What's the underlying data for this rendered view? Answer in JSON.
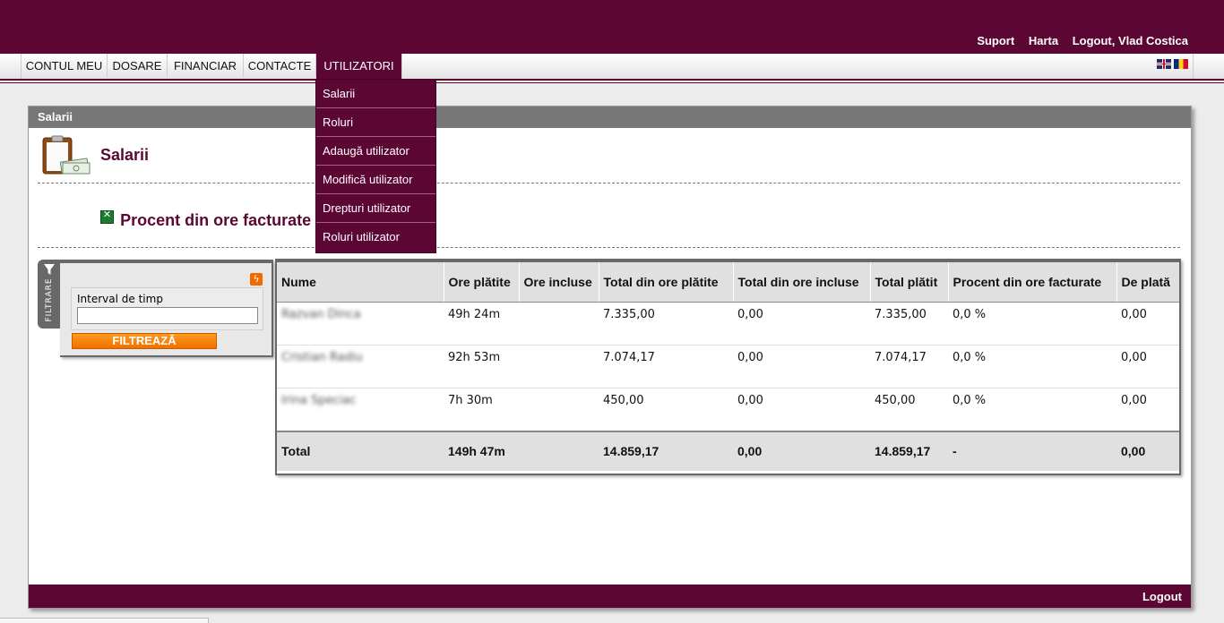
{
  "header": {
    "links": [
      "Suport",
      "Harta",
      "Logout, Vlad Costica"
    ]
  },
  "nav": {
    "items": [
      "CONTUL MEU",
      "DOSARE",
      "FINANCIAR",
      "CONTACTE",
      "UTILIZATORI"
    ],
    "active": "UTILIZATORI",
    "languages": [
      "english-flag-icon",
      "romanian-flag-icon"
    ]
  },
  "dropdown": {
    "items": [
      "Salarii",
      "Roluri",
      "Adaugă utilizator",
      "Modifică utilizator",
      "Drepturi utilizator",
      "Roluri utilizator"
    ]
  },
  "panel": {
    "header": "Salarii",
    "title": "Salarii",
    "report_link": "Procent din ore facturate"
  },
  "filter": {
    "tab_label": "FILTRARE",
    "field_label": "Interval de timp",
    "field_value": "",
    "button_label": "FILTREAZĂ"
  },
  "table": {
    "columns": [
      "Nume",
      "Ore plătite",
      "Ore incluse",
      "Total din ore plătite",
      "Total din ore incluse",
      "Total plătit",
      "Procent din ore facturate",
      "De plată"
    ],
    "rows": [
      [
        "Razvan Dinca",
        "49h 24m",
        "",
        "7.335,00",
        "0,00",
        "7.335,00",
        "0,0 %",
        "0,00"
      ],
      [
        "Cristian Radiu",
        "92h 53m",
        "",
        "7.074,17",
        "0,00",
        "7.074,17",
        "0,0 %",
        "0,00"
      ],
      [
        "Irina Speciac",
        "7h 30m",
        "",
        "450,00",
        "0,00",
        "450,00",
        "0,0 %",
        "0,00"
      ]
    ],
    "total": [
      "Total",
      "149h 47m",
      "",
      "14.859,17",
      "0,00",
      "14.859,17",
      "-",
      "0,00"
    ]
  },
  "footer": {
    "logout": "Logout"
  },
  "colors": {
    "brand": "#5c0733",
    "accent_orange": "#f07000",
    "panel_header": "#777777"
  }
}
